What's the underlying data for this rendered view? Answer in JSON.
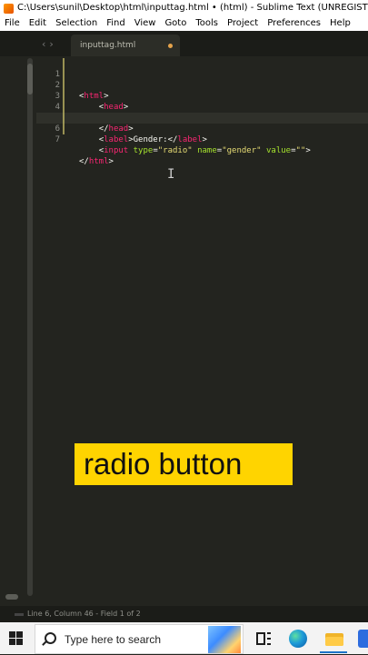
{
  "window": {
    "title": "C:\\Users\\sunil\\Desktop\\html\\inputtag.html • (html) - Sublime Text (UNREGISTERED)"
  },
  "menu": [
    "File",
    "Edit",
    "Selection",
    "Find",
    "View",
    "Goto",
    "Tools",
    "Project",
    "Preferences",
    "Help"
  ],
  "tab": {
    "label": "inputtag.html",
    "modified": true
  },
  "editor": {
    "line_numbers": [
      "1",
      "2",
      "3",
      "4",
      "5",
      "6",
      "7"
    ],
    "active_line": 6
  },
  "caption": {
    "text": "radio button",
    "background": "#ffd400"
  },
  "status": {
    "text": "Line 6, Column 46 - Field 1 of 2"
  },
  "taskbar": {
    "search_placeholder": "Type here to search",
    "icons": [
      "windows-start-icon",
      "search-icon",
      "task-view-icon",
      "edge-icon",
      "file-explorer-icon"
    ]
  },
  "colors": {
    "editor_bg": "#23241f",
    "tag": "#f92672",
    "attribute": "#a6e22e",
    "string": "#e6db74",
    "text": "#f8f8f2"
  }
}
